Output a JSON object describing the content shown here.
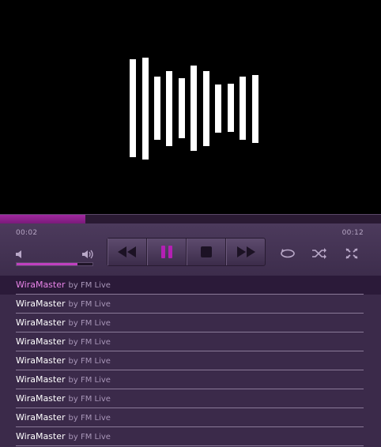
{
  "player": {
    "time_current": "00:02",
    "time_duration": "00:12",
    "progress_fraction": 0.225,
    "volume_fraction": 0.8,
    "accent_color": "#a0289f"
  },
  "controls": {
    "transport_icons": [
      "rewind-icon",
      "pause-icon",
      "stop-icon",
      "fast-forward-icon"
    ],
    "side_icons": [
      "repeat-icon",
      "shuffle-icon",
      "fullscreen-icon"
    ]
  },
  "playlist": {
    "items": [
      {
        "title": "WiraMaster",
        "by": "by FM Live"
      },
      {
        "title": "WiraMaster",
        "by": "by FM Live"
      },
      {
        "title": "WiraMaster",
        "by": "by FM Live"
      },
      {
        "title": "WiraMaster",
        "by": "by FM Live"
      },
      {
        "title": "WiraMaster",
        "by": "by FM Live"
      },
      {
        "title": "WiraMaster",
        "by": "by FM Live"
      },
      {
        "title": "WiraMaster",
        "by": "by FM Live"
      },
      {
        "title": "WiraMaster",
        "by": "by FM Live"
      },
      {
        "title": "WiraMaster",
        "by": "by FM Live"
      }
    ]
  }
}
